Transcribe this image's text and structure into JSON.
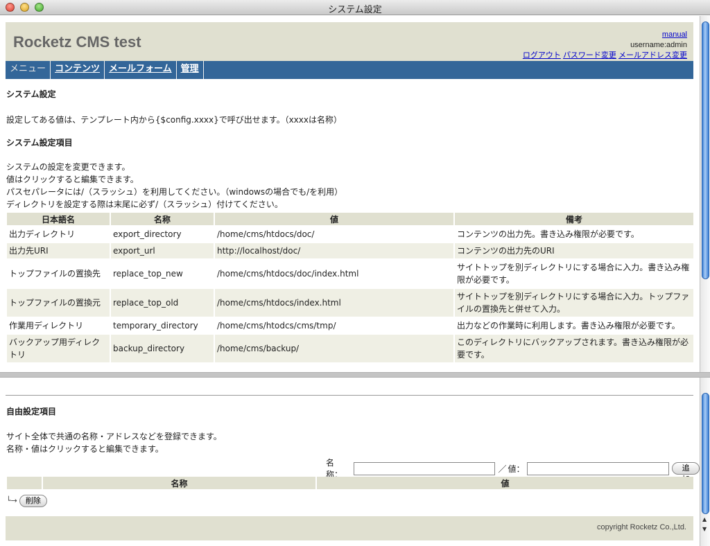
{
  "window": {
    "title": "システム設定"
  },
  "header": {
    "site_title": "Rocketz CMS test",
    "manual_link": "manual",
    "username": "username:admin",
    "links": [
      "ログアウト",
      "パスワード変更",
      "メールアドレス変更"
    ]
  },
  "menu": {
    "items": [
      {
        "label": "メニュー"
      },
      {
        "label": "コンテンツ"
      },
      {
        "label": "メールフォーム"
      },
      {
        "label": "管理"
      }
    ]
  },
  "page": {
    "title": "システム設定",
    "intro": "設定してある値は、テンプレート内から{$config.xxxx}で呼び出せます。（xxxxは名称）"
  },
  "system_settings": {
    "heading": "システム設定項目",
    "notes": [
      "システムの設定を変更できます。",
      "値はクリックすると編集できます。",
      "パスセパレータには/（スラッシュ）を利用してください。（windowsの場合でも/を利用）",
      "ディレクトリを設定する際は末尾に必ず/（スラッシュ）付けてください。"
    ],
    "columns": [
      "日本語名",
      "名称",
      "値",
      "備考"
    ],
    "rows": [
      [
        "出力ディレクトリ",
        "export_directory",
        "/home/cms/htdocs/doc/",
        "コンテンツの出力先。書き込み権限が必要です。"
      ],
      [
        "出力先URI",
        "export_url",
        "http://localhost/doc/",
        "コンテンツの出力先のURI"
      ],
      [
        "トップファイルの置換先",
        "replace_top_new",
        "/home/cms/htdocs/doc/index.html",
        "サイトトップを別ディレクトリにする場合に入力。書き込み権限が必要です。"
      ],
      [
        "トップファイルの置換元",
        "replace_top_old",
        "/home/cms/htdocs/index.html",
        "サイトトップを別ディレクトリにする場合に入力。トップファイルの置換先と併せて入力。"
      ],
      [
        "作業用ディレクトリ",
        "temporary_directory",
        "/home/cms/htodcs/cms/tmp/",
        "出力などの作業時に利用します。書き込み権限が必要です。"
      ],
      [
        "バックアップ用ディレクトリ",
        "backup_directory",
        "/home/cms/backup/",
        "このディレクトリにバックアップされます。書き込み権限が必要です。"
      ]
    ]
  },
  "free_settings": {
    "heading": "自由設定項目",
    "notes": [
      "サイト全体で共通の名称・アドレスなどを登録できます。",
      "名称・値はクリックすると編集できます。"
    ],
    "name_label": "名称：",
    "separator": "／",
    "value_label": "値：",
    "name_value": "",
    "value_value": "",
    "add_button": "追加",
    "columns": [
      "",
      "名称",
      "値"
    ],
    "branch_glyph": "└→",
    "delete_button": "削除"
  },
  "footer": {
    "copyright": "copyright Rocketz Co.,Ltd."
  }
}
